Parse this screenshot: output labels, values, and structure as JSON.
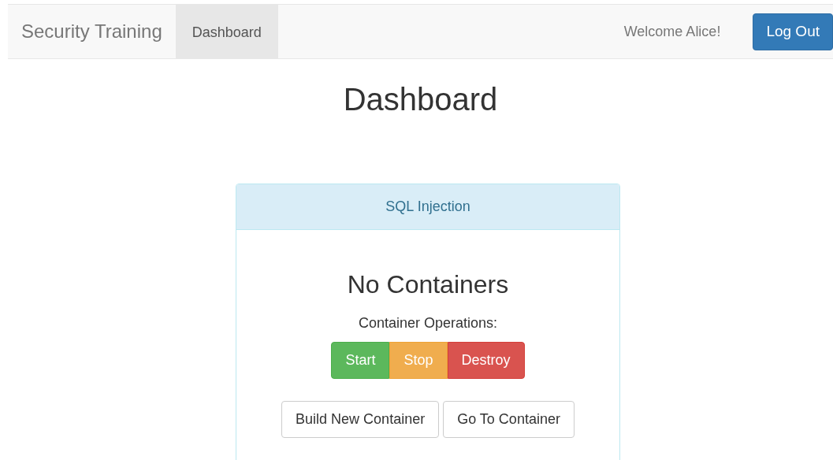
{
  "navbar": {
    "brand": "Security Training",
    "tabs": [
      {
        "label": "Dashboard",
        "selected": true
      }
    ],
    "welcome": "Welcome Alice!",
    "logout_button": "Log Out"
  },
  "page_title": "Dashboard",
  "panel": {
    "title": "SQL Injection",
    "status": "No Containers",
    "operations_label": "Container Operations:",
    "operation_buttons": [
      {
        "label": "Start",
        "kind": "success"
      },
      {
        "label": "Stop",
        "kind": "warning"
      },
      {
        "label": "Destroy",
        "kind": "danger"
      }
    ],
    "action_buttons": [
      "Build New Container",
      "Go To Container"
    ]
  }
}
